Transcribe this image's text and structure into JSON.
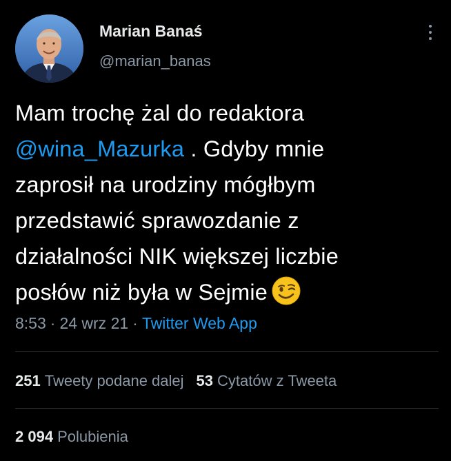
{
  "user": {
    "display_name": "Marian Banaś",
    "handle": "@marian_banas"
  },
  "tweet": {
    "lines": [
      {
        "before": "Mam trochę żal do redaktora",
        "mention": "",
        "after": ""
      },
      {
        "before": "",
        "mention": "@wina_Mazurka",
        "after": " . Gdyby mnie"
      },
      {
        "before": "zaprosił na urodziny mógłbym",
        "mention": "",
        "after": ""
      },
      {
        "before": "przedstawić sprawozdanie z",
        "mention": "",
        "after": ""
      },
      {
        "before": "działalności NIK większej liczbie",
        "mention": "",
        "after": ""
      },
      {
        "before": "posłów niż była w Sejmie",
        "mention": "",
        "after": ""
      }
    ],
    "emoji": "winking-face"
  },
  "meta": {
    "time": "8:53",
    "separator": "·",
    "date": "24 wrz 21",
    "source": "Twitter Web App"
  },
  "stats": {
    "retweets": {
      "count": "251",
      "label": "Tweety podane dalej"
    },
    "quotes": {
      "count": "53",
      "label": "Cytatów z Tweeta"
    },
    "likes": {
      "count": "2 094",
      "label": "Polubienia"
    }
  },
  "colors": {
    "background": "#000000",
    "text": "#e7e9ea",
    "secondary": "#8b98a5",
    "accent": "#1d9bf0",
    "divider": "#2f3336"
  },
  "icons": [
    "avatar-photo",
    "more-options-icon",
    "winking-face-emoji"
  ]
}
